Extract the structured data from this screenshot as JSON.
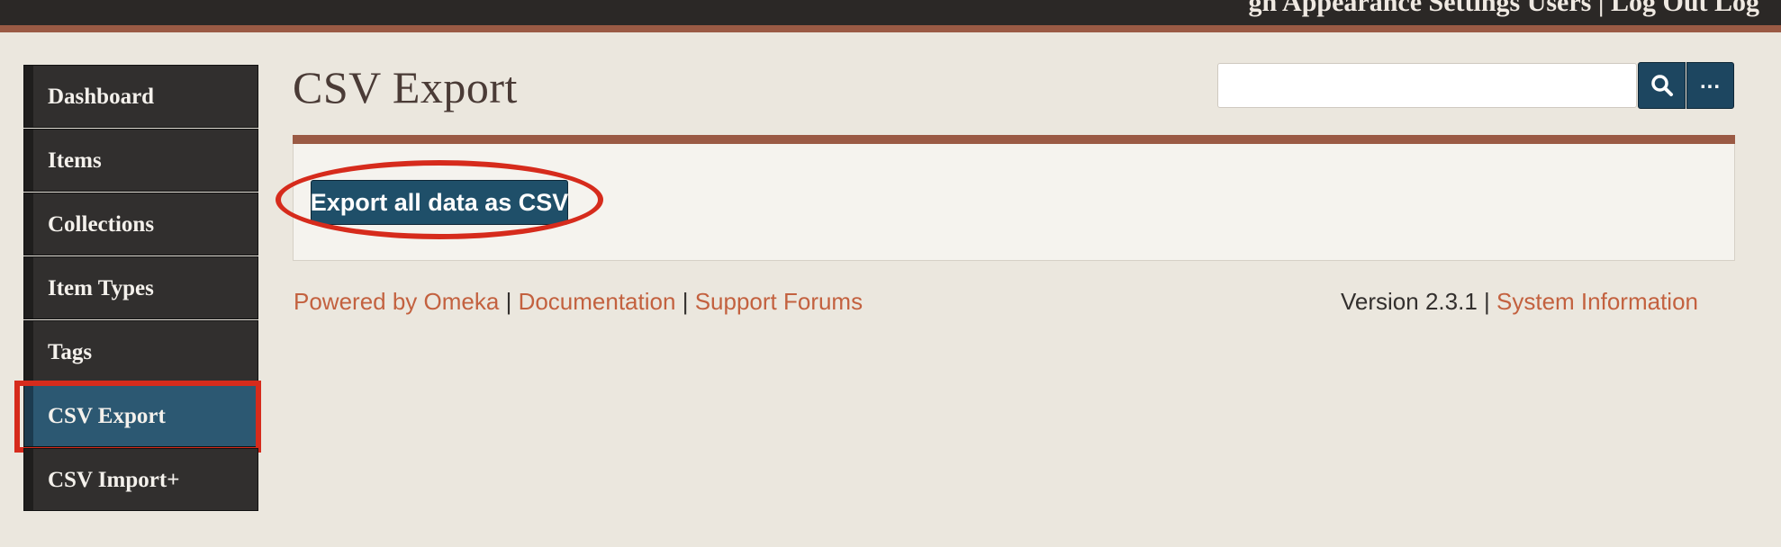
{
  "topbar": {
    "partial_text": "gn Appearance Settings Users | Log Out  Log"
  },
  "sidebar": {
    "items": [
      {
        "label": "Dashboard"
      },
      {
        "label": "Items"
      },
      {
        "label": "Collections"
      },
      {
        "label": "Item Types"
      },
      {
        "label": "Tags"
      },
      {
        "label": "CSV Export"
      },
      {
        "label": "CSV Import+"
      }
    ],
    "active_item": "CSV Export"
  },
  "page": {
    "title": "CSV Export"
  },
  "search": {
    "value": "",
    "advanced_label": "..."
  },
  "panel": {
    "export_button_label": "Export all data as CSV"
  },
  "footer": {
    "powered_by": "Powered by Omeka",
    "documentation": "Documentation",
    "support_forums": "Support Forums",
    "separator": "|",
    "version": "Version 2.3.1",
    "system_information": "System Information"
  },
  "colors": {
    "accent": "#9a5a44",
    "active_nav": "#2c5872",
    "button": "#1f4f69",
    "link": "#c3613f",
    "highlight": "#d62b1c"
  },
  "icons": [
    "search-icon"
  ]
}
